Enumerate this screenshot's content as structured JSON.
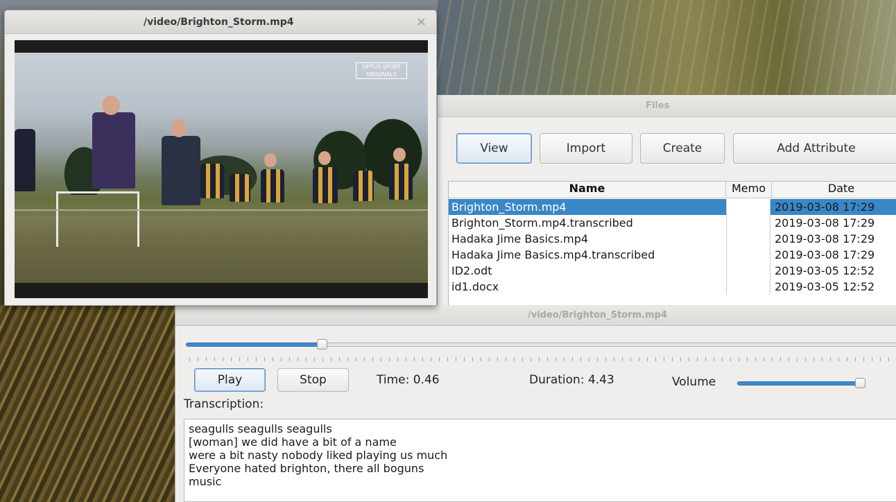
{
  "video_window": {
    "title": "/video/Brighton_Storm.mp4",
    "close_glyph": "×",
    "overlay_logo_line1": "OPTUS SPORT",
    "overlay_logo_line2": "ORIGINALS"
  },
  "files_window": {
    "title": "Files",
    "buttons": {
      "view": "View",
      "import": "Import",
      "create": "Create",
      "add_attribute": "Add Attribute"
    },
    "table": {
      "columns": [
        "Name",
        "Memo",
        "Date"
      ],
      "rows": [
        {
          "name": "Brighton_Storm.mp4",
          "memo": "",
          "date": "2019-03-08 17:29",
          "selected": true
        },
        {
          "name": "Brighton_Storm.mp4.transcribed",
          "memo": "",
          "date": "2019-03-08 17:29"
        },
        {
          "name": "Hadaka Jime Basics.mp4",
          "memo": "",
          "date": "2019-03-08 17:29"
        },
        {
          "name": "Hadaka Jime Basics.mp4.transcribed",
          "memo": "",
          "date": "2019-03-08 17:29"
        },
        {
          "name": "ID2.odt",
          "memo": "",
          "date": "2019-03-05 12:52"
        },
        {
          "name": "id1.docx",
          "memo": "",
          "date": "2019-03-05 12:52"
        }
      ]
    }
  },
  "player_window": {
    "title": "/video/Brighton_Storm.mp4",
    "play_label": "Play",
    "stop_label": "Stop",
    "time_text": "Time: 0.46",
    "duration_text": "Duration: 4.43",
    "volume_label": "Volume",
    "seek_position": 0.19,
    "volume_level": 1.0,
    "transcription_label": "Transcription:",
    "transcription_lines": [
      "seagulls seagulls seagulls",
      "[woman] we did have a bit of a name",
      "were a bit nasty nobody liked playing us much",
      "Everyone hated brighton, there all boguns",
      "music"
    ]
  },
  "colors": {
    "selection": "#3a87c8",
    "slider_fill": "#3d8bd0"
  }
}
